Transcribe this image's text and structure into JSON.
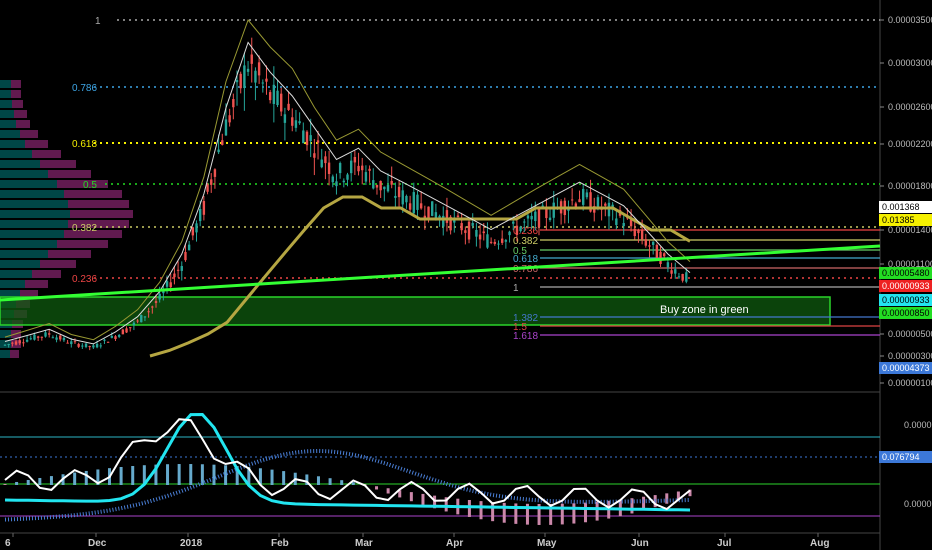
{
  "chart_data": {
    "type": "line",
    "price_axis": {
      "ticks": [
        "0.00003500",
        "0.00003000",
        "0.00002600",
        "0.00002200",
        "0.00001800",
        "0.00001400",
        "0.00001100",
        "0.00000800",
        "0.00000500",
        "0.00000300",
        "0.00000100"
      ],
      "tick_values": [
        3.5e-05,
        3e-05,
        2.6e-05,
        2.2e-05,
        1.8e-05,
        1.4e-05,
        1.1e-05,
        8e-06,
        5e-06,
        3e-06,
        1e-06
      ]
    },
    "indicator_axis": {
      "ticks": [
        "0.0000",
        "0.0000"
      ]
    },
    "x_axis": {
      "labels": [
        "6",
        "Dec",
        "2018",
        "Feb",
        "Mar",
        "Apr",
        "May",
        "Jun",
        "Jul",
        "Aug"
      ]
    },
    "price_tags": [
      {
        "text": "0.001368",
        "bg": "#ffffff",
        "fg": "#000000"
      },
      {
        "text": "0.01385",
        "bg": "#f5f000",
        "fg": "#000000"
      },
      {
        "text": "0.00005480",
        "bg": "#22dd22",
        "fg": "#000000"
      },
      {
        "text": "0.00000933",
        "bg": "#ee2222",
        "fg": "#ffffff"
      },
      {
        "text": "0.00000933",
        "bg": "#22e5f0",
        "fg": "#000000"
      },
      {
        "text": "0.00000850",
        "bg": "#22dd22",
        "fg": "#000000"
      },
      {
        "text": "0.00004373",
        "bg": "#3c78d8",
        "fg": "#ffffff"
      },
      {
        "text": "0.076794",
        "bg": "#3c78d8",
        "fg": "#ffffff"
      }
    ],
    "fib_levels_left": [
      {
        "label": "1",
        "color": "#aaaaaa"
      },
      {
        "label": "0.786",
        "color": "#3ea6e6"
      },
      {
        "label": "0.618",
        "color": "#f5f000"
      },
      {
        "label": "0.5",
        "color": "#22dd22"
      },
      {
        "label": "0.382",
        "color": "#cccc66"
      },
      {
        "label": "0.236",
        "color": "#ee4444"
      }
    ],
    "fib_levels_right": [
      {
        "label": "0.236",
        "color": "#ee4444"
      },
      {
        "label": "0.382",
        "color": "#cccc66"
      },
      {
        "label": "0.5",
        "color": "#66cc66"
      },
      {
        "label": "0.618",
        "color": "#44aacc"
      },
      {
        "label": "0.786",
        "color": "#cc6666"
      },
      {
        "label": "1",
        "color": "#aaaaaa"
      },
      {
        "label": "1.382",
        "color": "#4477cc"
      },
      {
        "label": "1.5",
        "color": "#dd4444"
      },
      {
        "label": "1.618",
        "color": "#aa44cc"
      }
    ],
    "annotation": "Buy zone in green",
    "series": [
      {
        "values": [
          4e-06,
          4.5e-06,
          5e-06,
          4.2e-06,
          3.8e-06,
          4.8e-06,
          6e-06,
          8e-06,
          1.1e-05,
          1.6e-05,
          2.4e-05,
          3e-05,
          2.7e-05,
          2.5e-05,
          2.2e-05,
          1.9e-05,
          2e-05,
          1.8e-05,
          1.7e-05,
          1.6e-05,
          1.5e-05,
          1.4e-05,
          1.3e-05,
          1.4e-05,
          1.5e-05,
          1.6e-05,
          1.7e-05,
          1.6e-05,
          1.5e-05,
          1.3e-05,
          1.1e-05,
          9.5e-06
        ]
      },
      {
        "values": [
          3e-06,
          3.5e-06,
          4.2e-06,
          5e-06,
          6e-06,
          8e-06,
          1e-05,
          1.2e-05,
          1.4e-05,
          1.6e-05,
          1.7e-05,
          1.7e-05,
          1.6e-05,
          1.6e-05,
          1.5e-05,
          1.5e-05,
          1.5e-05,
          1.5e-05,
          1.5e-05,
          1.5e-05,
          1.6e-05,
          1.6e-05,
          1.6e-05,
          1.6e-05,
          1.6e-05,
          1.5e-05,
          1.4e-05,
          1.4e-05,
          1.3e-05
        ]
      }
    ]
  }
}
